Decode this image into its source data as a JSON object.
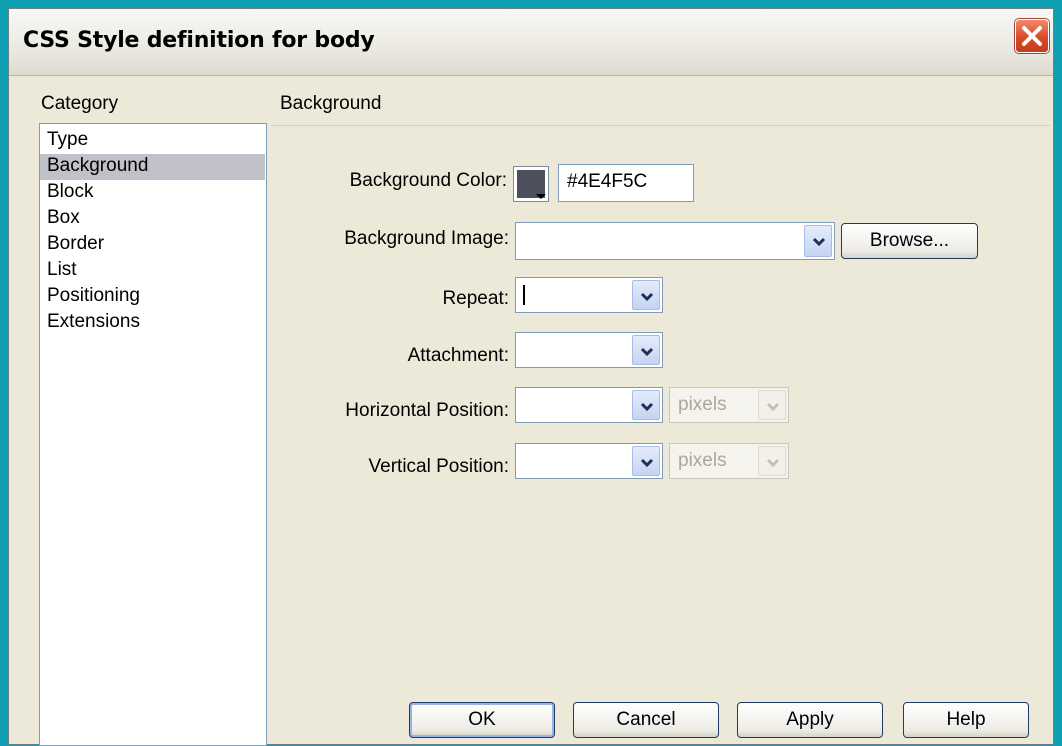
{
  "window": {
    "title": "CSS Style definition for body"
  },
  "category": {
    "label": "Category",
    "items": [
      "Type",
      "Background",
      "Block",
      "Box",
      "Border",
      "List",
      "Positioning",
      "Extensions"
    ],
    "selected": "Background"
  },
  "panel": {
    "title": "Background",
    "background_color": {
      "label": "Background Color:",
      "value": "#4E4F5C",
      "swatch_color": "#4E4F5C"
    },
    "background_image": {
      "label": "Background Image:",
      "value": "",
      "browse_label": "Browse..."
    },
    "repeat": {
      "label": "Repeat:",
      "value": ""
    },
    "attachment": {
      "label": "Attachment:",
      "value": ""
    },
    "horizontal_position": {
      "label": "Horizontal Position:",
      "value": "",
      "unit": "pixels"
    },
    "vertical_position": {
      "label": "Vertical Position:",
      "value": "",
      "unit": "pixels"
    }
  },
  "buttons": {
    "ok": "OK",
    "cancel": "Cancel",
    "apply": "Apply",
    "help": "Help"
  },
  "colors": {
    "frame": "#0f9fb2",
    "dialog_bg": "#ece9d8",
    "selected_item": "#c1c1c9"
  }
}
